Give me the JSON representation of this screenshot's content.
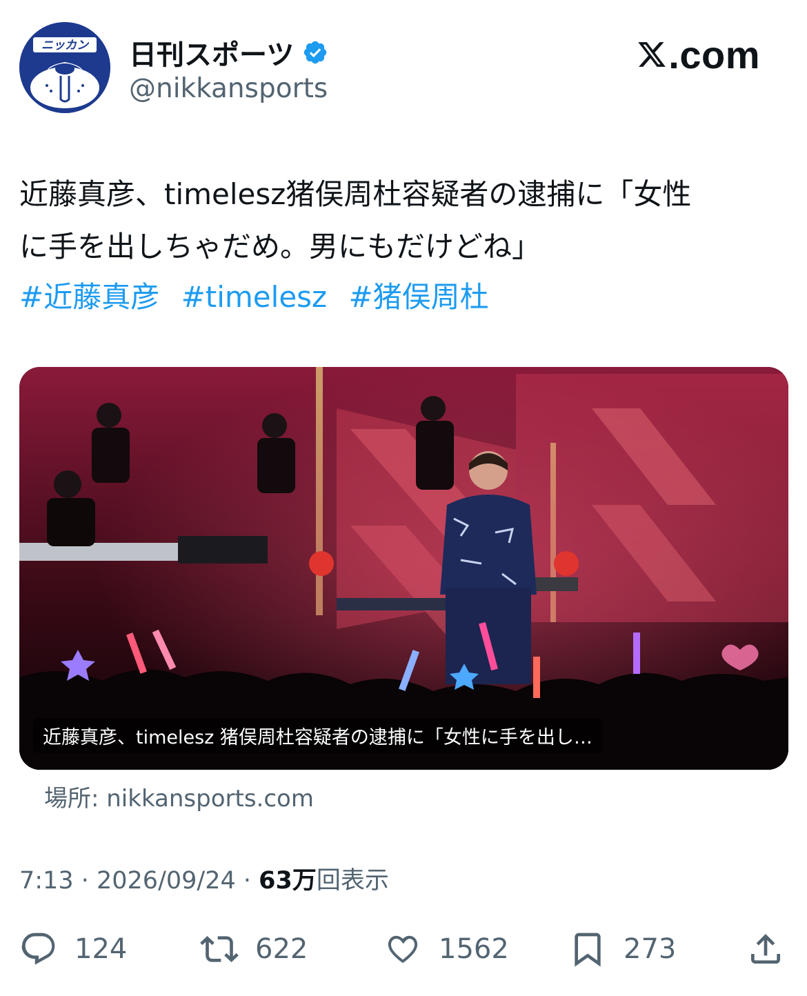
{
  "account": {
    "display_name": "日刊スポーツ",
    "handle": "@nikkansports",
    "verified": true,
    "avatar_text": "ニッカン",
    "avatar_color": "#1d3a8f"
  },
  "brand": {
    "site_label": ".com",
    "logo_icon": "x-logo-icon"
  },
  "tweet": {
    "text_lines": [
      "近藤真彦、timelesz猪俣周杜容疑者の逮捕に「女性",
      "に手を出しちゃだめ。男にもだけどね」"
    ],
    "hashtags": [
      "#近藤真彦",
      "#timelesz",
      "#猪俣周杜"
    ]
  },
  "card": {
    "caption": "近藤真彦、timelesz 猪俣周杜容疑者の逮捕に「女性に手を出し…",
    "source": "場所: nikkansports.com"
  },
  "meta": {
    "time": "7:13",
    "sep1": " · ",
    "date": "2026/09/24",
    "sep2": " · ",
    "views_count": "63万",
    "views_label": "回表示"
  },
  "actions": {
    "replies": "124",
    "retweets": "622",
    "likes": "1562",
    "bookmarks": "273"
  },
  "colors": {
    "link": "#1d9bf0",
    "verified": "#1d9bf0",
    "secondary_text": "#536471"
  }
}
